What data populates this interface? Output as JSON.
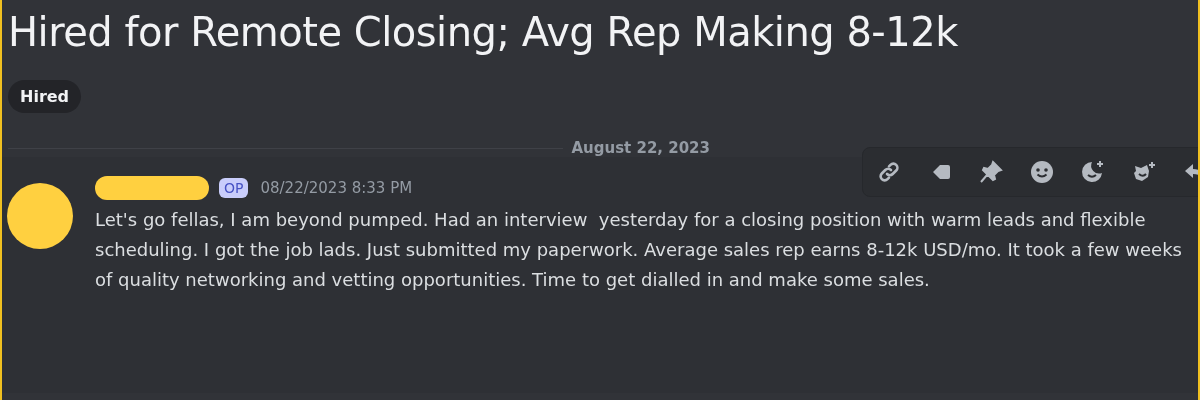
{
  "title": "Hired for Remote Closing; Avg Rep Making 8-12k",
  "tags": [
    "Hired"
  ],
  "date_divider": "August 22, 2023",
  "message": {
    "badge": "OP",
    "timestamp": "08/22/2023 8:33 PM",
    "text": "Let's go fellas, I am beyond pumped. Had an interview  yesterday for a closing position with warm leads and flexible scheduling. I got the job lads. Just submitted my paperwork. Average sales rep earns 8-12k USD/mo. It took a few weeks of quality networking and vetting opportunities. Time to get dialled in and make some sales."
  },
  "toolbar": [
    {
      "kind": "link"
    },
    {
      "kind": "tag"
    },
    {
      "kind": "pin"
    },
    {
      "kind": "emoji"
    },
    {
      "kind": "super-react"
    },
    {
      "kind": "react"
    },
    {
      "kind": "reply"
    }
  ]
}
